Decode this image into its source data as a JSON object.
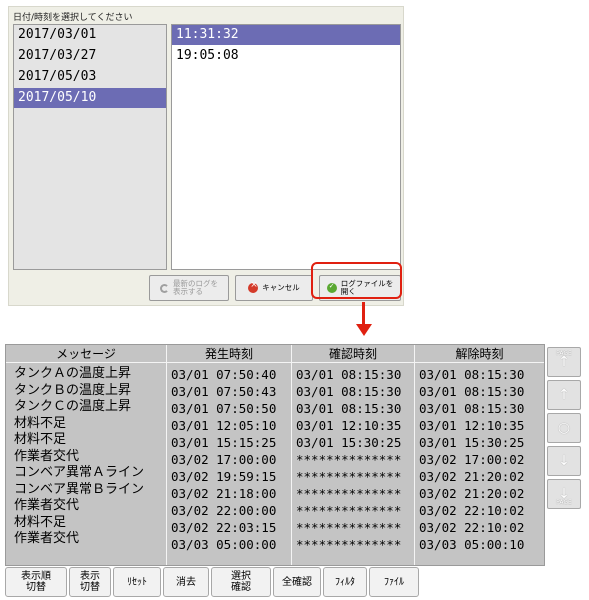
{
  "dialog": {
    "title": "日付/時刻を選択してください",
    "dates": [
      "2017/03/01",
      "2017/03/27",
      "2017/05/03",
      "2017/05/10"
    ],
    "selected_date_index": 3,
    "times": [
      "11:31:32",
      "19:05:08"
    ],
    "selected_time_index": 0,
    "buttons": {
      "latest_log": "最新のログを\n表示する",
      "cancel": "キャンセル",
      "open_log": "ログファイルを\n開く"
    }
  },
  "colors": {
    "highlight": "#e02010",
    "selection": "#6c6cb4"
  },
  "log_table": {
    "headers": {
      "message": "メッセージ",
      "occurred": "発生時刻",
      "confirmed": "確認時刻",
      "cleared": "解除時刻"
    },
    "messages": [
      "タンクＡの温度上昇",
      "タンクＢの温度上昇",
      "タンクＣの温度上昇",
      "材料不足",
      "材料不足",
      "作業者交代",
      "コンベア異常Ａライン",
      "コンベア異常Ｂライン",
      "作業者交代",
      "材料不足",
      "作業者交代"
    ],
    "occurred": [
      "03/01 07:50:40",
      "03/01 07:50:43",
      "03/01 07:50:50",
      "03/01 12:05:10",
      "03/01 15:15:25",
      "03/02 17:00:00",
      "03/02 19:59:15",
      "03/02 21:18:00",
      "03/02 22:00:00",
      "03/02 22:03:15",
      "03/03 05:00:00"
    ],
    "confirmed": [
      "03/01 08:15:30",
      "03/01 08:15:30",
      "03/01 08:15:30",
      "03/01 12:10:35",
      "03/01 15:30:25",
      "**************",
      "**************",
      "**************",
      "**************",
      "**************",
      "**************"
    ],
    "cleared": [
      "03/01 08:15:30",
      "03/01 08:15:30",
      "03/01 08:15:30",
      "03/01 12:10:35",
      "03/01 15:30:25",
      "03/02 17:00:02",
      "03/02 21:20:02",
      "03/02 21:20:02",
      "03/02 22:10:02",
      "03/02 22:10:02",
      "03/03 05:00:10"
    ]
  },
  "side_buttons": {
    "page_label": "PAGE",
    "page_up": "↑",
    "up": "↑",
    "center": "○",
    "down": "↓",
    "page_down": "↓"
  },
  "toolbar": {
    "display_order": "表示順\n切替",
    "display_toggle": "表示\n切替",
    "reset": "ﾘｾｯﾄ",
    "delete": "消去",
    "confirm_selected": "選択\n確認",
    "confirm_all": "全確認",
    "filter": "ﾌｨﾙﾀ",
    "file": "ﾌｧｲﾙ"
  }
}
